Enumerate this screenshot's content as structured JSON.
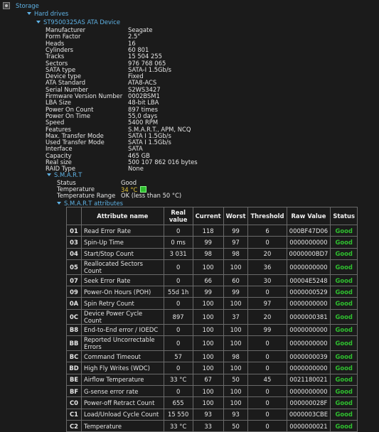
{
  "tree": {
    "storage": "Storage",
    "hard_drives": "Hard drives",
    "device": "ST9500325AS ATA Device",
    "smart_node": "S.M.A.R.T",
    "smart_attributes_node": "S.M.A.R.T attributes"
  },
  "properties": [
    {
      "label": "Manufacturer",
      "value": "Seagate"
    },
    {
      "label": "Form Factor",
      "value": "2.5\""
    },
    {
      "label": "Heads",
      "value": "16"
    },
    {
      "label": "Cylinders",
      "value": "60 801"
    },
    {
      "label": "Tracks",
      "value": "15 504 255"
    },
    {
      "label": "Sectors",
      "value": "976 768 065"
    },
    {
      "label": "SATA type",
      "value": "SATA-I 1.5Gb/s"
    },
    {
      "label": "Device type",
      "value": "Fixed"
    },
    {
      "label": "ATA Standard",
      "value": "ATA8-ACS"
    },
    {
      "label": "Serial Number",
      "value": "S2WS3427"
    },
    {
      "label": "Firmware Version Number",
      "value": "0002BSM1"
    },
    {
      "label": "LBA Size",
      "value": "48-bit LBA"
    },
    {
      "label": "Power On Count",
      "value": "897 times"
    },
    {
      "label": "Power On Time",
      "value": "55,0 days"
    },
    {
      "label": "Speed",
      "value": "5400 RPM"
    },
    {
      "label": "Features",
      "value": "S.M.A.R.T., APM, NCQ"
    },
    {
      "label": "Max. Transfer Mode",
      "value": "SATA I 1.5Gb/s"
    },
    {
      "label": "Used Transfer Mode",
      "value": "SATA I 1.5Gb/s"
    },
    {
      "label": "Interface",
      "value": "SATA"
    },
    {
      "label": "Capacity",
      "value": "465 GB"
    },
    {
      "label": "Real size",
      "value": "500 107 862 016 bytes"
    },
    {
      "label": "RAID Type",
      "value": "None"
    }
  ],
  "smart": {
    "status_label": "Status",
    "status_value": "Good",
    "temperature_label": "Temperature",
    "temperature_value": "34 °C",
    "temperature_range_label": "Temperature Range",
    "temperature_range_value": "OK (less than 50 °C)",
    "colors": {
      "accent": "#5fb3e6",
      "good": "#2fbf2f",
      "temp": "#e0c238"
    }
  },
  "table": {
    "headers": [
      "",
      "Attribute name",
      "Real value",
      "Current",
      "Worst",
      "Threshold",
      "Raw Value",
      "Status"
    ],
    "rows": [
      [
        "01",
        "Read Error Rate",
        "0",
        "118",
        "99",
        "6",
        "000BF47D06",
        "Good"
      ],
      [
        "03",
        "Spin-Up Time",
        "0 ms",
        "99",
        "97",
        "0",
        "0000000000",
        "Good"
      ],
      [
        "04",
        "Start/Stop Count",
        "3 031",
        "98",
        "98",
        "20",
        "0000000BD7",
        "Good"
      ],
      [
        "05",
        "Reallocated Sectors Count",
        "0",
        "100",
        "100",
        "36",
        "0000000000",
        "Good"
      ],
      [
        "07",
        "Seek Error Rate",
        "0",
        "66",
        "60",
        "30",
        "00004E5248",
        "Good"
      ],
      [
        "09",
        "Power-On Hours (POH)",
        "55d 1h",
        "99",
        "99",
        "0",
        "0000000529",
        "Good"
      ],
      [
        "0A",
        "Spin Retry Count",
        "0",
        "100",
        "100",
        "97",
        "0000000000",
        "Good"
      ],
      [
        "0C",
        "Device Power Cycle Count",
        "897",
        "100",
        "37",
        "20",
        "0000000381",
        "Good"
      ],
      [
        "B8",
        "End-to-End error / IOEDC",
        "0",
        "100",
        "100",
        "99",
        "0000000000",
        "Good"
      ],
      [
        "BB",
        "Reported Uncorrectable Errors",
        "0",
        "100",
        "100",
        "0",
        "0000000000",
        "Good"
      ],
      [
        "BC",
        "Command Timeout",
        "57",
        "100",
        "98",
        "0",
        "0000000039",
        "Good"
      ],
      [
        "BD",
        "High Fly Writes (WDC)",
        "0",
        "100",
        "100",
        "0",
        "0000000000",
        "Good"
      ],
      [
        "BE",
        "Airflow Temperature",
        "33 °C",
        "67",
        "50",
        "45",
        "0021180021",
        "Good"
      ],
      [
        "BF",
        "G-sense error rate",
        "0",
        "100",
        "100",
        "0",
        "0000000000",
        "Good"
      ],
      [
        "C0",
        "Power-off Retract Count",
        "655",
        "100",
        "100",
        "0",
        "000000028F",
        "Good"
      ],
      [
        "C1",
        "Load/Unload Cycle Count",
        "15 550",
        "93",
        "93",
        "0",
        "0000003CBE",
        "Good"
      ],
      [
        "C2",
        "Temperature",
        "33 °C",
        "33",
        "50",
        "0",
        "0000000021",
        "Good"
      ]
    ]
  }
}
